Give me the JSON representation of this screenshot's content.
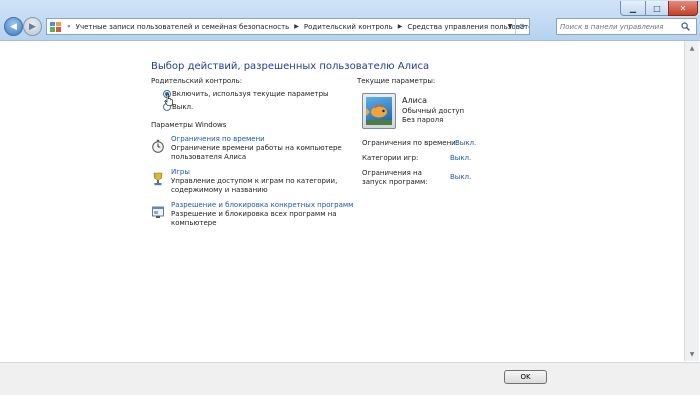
{
  "nav": {
    "back_icon": "back-arrow-icon",
    "forward_icon": "forward-arrow-icon"
  },
  "address": {
    "chevron": "«",
    "crumbs": [
      "Учетные записи пользователей и семейная безопасность",
      "Родительский контроль",
      "Средства управления пользователем"
    ]
  },
  "search": {
    "placeholder": "Поиск в панели управления"
  },
  "page": {
    "heading": "Выбор действий, разрешенных пользователю Алиса",
    "parental_control_label": "Родительский контроль:",
    "radio_on_label": "Включить, используя текущие параметры",
    "radio_off_label": "Выкл.",
    "windows_settings_label": "Параметры Windows"
  },
  "options": [
    {
      "link": "Ограничения по времени",
      "desc_line1": "Ограничение времени работы на компьютере",
      "desc_line2": "пользователя Алиса"
    },
    {
      "link": "Игры",
      "desc_line1": "Управление доступом к играм по категории,",
      "desc_line2": "содержимому и названию"
    },
    {
      "link": "Разрешение и блокировка конкретных программ",
      "desc_line1": "Разрешение и блокировка всех программ на",
      "desc_line2": "компьютере"
    }
  ],
  "current": {
    "label": "Текущие параметры:",
    "user_name": "Алиса",
    "user_type": "Обычный доступ",
    "user_password": "Без пароля",
    "time_label": "Ограничения по времени:",
    "time_value": "Выкл.",
    "games_label": "Категории игр:",
    "games_value": "Выкл.",
    "programs_label_line1": "Ограничения на",
    "programs_label_line2": "запуск программ:",
    "programs_value": "Выкл."
  },
  "footer": {
    "ok_label": "OK"
  },
  "colors": {
    "heading": "#1e3f8f",
    "link": "#1a57b8"
  }
}
